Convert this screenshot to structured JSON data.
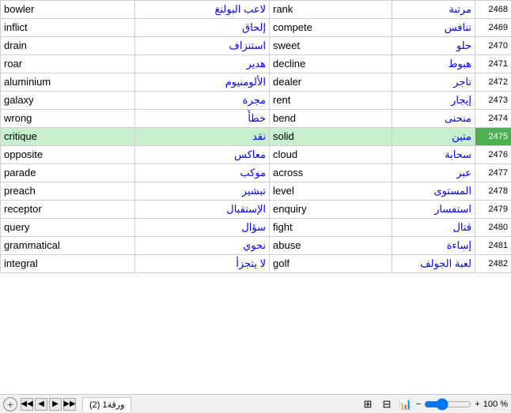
{
  "rows": [
    {
      "en": "bowler",
      "ar_left": "لاعب البولنغ",
      "en2": "rank",
      "ar_right": "مرتبة",
      "num": "2468",
      "highlight": false
    },
    {
      "en": "inflict",
      "ar_left": "إلحاق",
      "en2": "compete",
      "ar_right": "تنافس",
      "num": "2469",
      "highlight": false
    },
    {
      "en": "drain",
      "ar_left": "استنزاف",
      "en2": "sweet",
      "ar_right": "حلو",
      "num": "2470",
      "highlight": false
    },
    {
      "en": "roar",
      "ar_left": "هدير",
      "en2": "decline",
      "ar_right": "هبوط",
      "num": "2471",
      "highlight": false
    },
    {
      "en": "aluminium",
      "ar_left": "الألومنيوم",
      "en2": "dealer",
      "ar_right": "تاجر",
      "num": "2472",
      "highlight": false
    },
    {
      "en": "galaxy",
      "ar_left": "مجرة",
      "en2": "rent",
      "ar_right": "إيجار",
      "num": "2473",
      "highlight": false
    },
    {
      "en": "wrong",
      "ar_left": "خطأً",
      "en2": "bend",
      "ar_right": "منحنى",
      "num": "2474",
      "highlight": false
    },
    {
      "en": "critique",
      "ar_left": "نقد",
      "en2": "solid",
      "ar_right": "متين",
      "num": "2475",
      "highlight": true
    },
    {
      "en": "opposite",
      "ar_left": "معاكس",
      "en2": "cloud",
      "ar_right": "سحابة",
      "num": "2476",
      "highlight": false
    },
    {
      "en": "parade",
      "ar_left": "موكب",
      "en2": "across",
      "ar_right": "عبر",
      "num": "2477",
      "highlight": false
    },
    {
      "en": "preach",
      "ar_left": "تبشير",
      "en2": "level",
      "ar_right": "المستوى",
      "num": "2478",
      "highlight": false
    },
    {
      "en": "receptor",
      "ar_left": "الإستقبال",
      "en2": "enquiry",
      "ar_right": "استفسار",
      "num": "2479",
      "highlight": false
    },
    {
      "en": "query",
      "ar_left": "سؤال",
      "en2": "fight",
      "ar_right": "قتال",
      "num": "2480",
      "highlight": false
    },
    {
      "en": "grammatical",
      "ar_left": "نحوي",
      "en2": "abuse",
      "ar_right": "إساءة",
      "num": "2481",
      "highlight": false
    },
    {
      "en": "integral",
      "ar_left": "لا يتجزأ",
      "en2": "golf",
      "ar_right": "لعبة الجولف",
      "num": "2482",
      "highlight": false
    }
  ],
  "sheet_tab": "ورقة1 (2)",
  "zoom": "100 %",
  "add_sheet": "+",
  "nav_left1": "◀◀",
  "nav_left2": "◀",
  "nav_right1": "▶",
  "nav_right2": "▶▶"
}
